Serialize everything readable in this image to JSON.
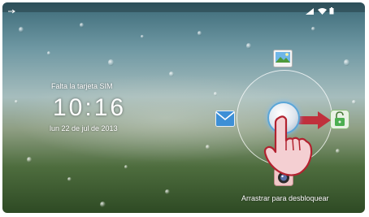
{
  "lockscreen": {
    "sim_status": "Falta la tarjeta SIM",
    "time": "10:16",
    "date": "lun 22 de jul de 2013",
    "unlock_hint": "Arrastrar para desbloquear"
  },
  "status_bar": {
    "icons": [
      "usb-icon",
      "signal-icon",
      "wifi-icon",
      "battery-icon"
    ]
  },
  "unlock_targets": [
    "gallery-icon",
    "messages-icon",
    "unlock-icon",
    "camera-icon"
  ],
  "colors": {
    "accent": "#5aa6d8",
    "arrow": "#c0303c",
    "unlock_green": "#4caf50"
  }
}
